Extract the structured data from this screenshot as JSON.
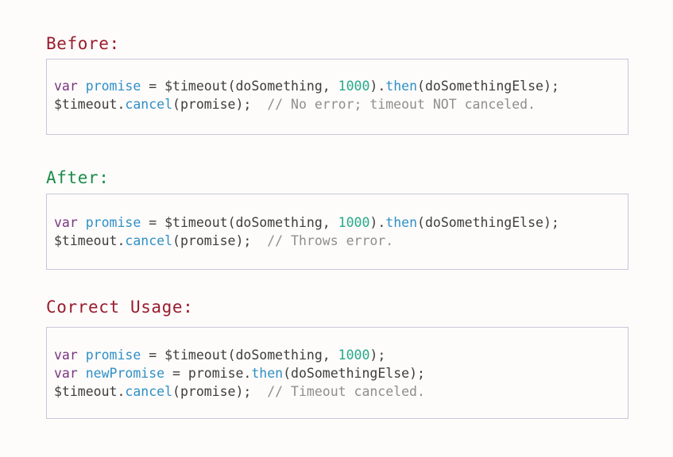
{
  "colors": {
    "heading_red": "#9b1c2c",
    "heading_green": "#1c8c4a",
    "keyword": "#7a3580",
    "identifier_blue": "#2f8fc6",
    "number": "#27a989",
    "comment": "#8e8e8e",
    "plain": "#3d3d3d",
    "border": "#c8c6d8"
  },
  "sections": [
    {
      "heading": "Before:",
      "lines": [
        [
          {
            "t": "var",
            "c": "kw"
          },
          {
            "t": " ",
            "c": "pl"
          },
          {
            "t": "promise",
            "c": "var"
          },
          {
            "t": " = $timeout(doSomething, ",
            "c": "pl"
          },
          {
            "t": "1000",
            "c": "num"
          },
          {
            "t": ").",
            "c": "pl"
          },
          {
            "t": "then",
            "c": "fn"
          },
          {
            "t": "(doSomethingElse);",
            "c": "pl"
          }
        ],
        [
          {
            "t": "$timeout.",
            "c": "pl"
          },
          {
            "t": "cancel",
            "c": "fn"
          },
          {
            "t": "(promise);  ",
            "c": "pl"
          },
          {
            "t": "// No error; timeout NOT canceled.",
            "c": "cm"
          }
        ]
      ]
    },
    {
      "heading": "After:",
      "lines": [
        [
          {
            "t": "var",
            "c": "kw"
          },
          {
            "t": " ",
            "c": "pl"
          },
          {
            "t": "promise",
            "c": "var"
          },
          {
            "t": " = $timeout(doSomething, ",
            "c": "pl"
          },
          {
            "t": "1000",
            "c": "num"
          },
          {
            "t": ").",
            "c": "pl"
          },
          {
            "t": "then",
            "c": "fn"
          },
          {
            "t": "(doSomethingElse);",
            "c": "pl"
          }
        ],
        [
          {
            "t": "$timeout.",
            "c": "pl"
          },
          {
            "t": "cancel",
            "c": "fn"
          },
          {
            "t": "(promise);  ",
            "c": "pl"
          },
          {
            "t": "// Throws error.",
            "c": "cm"
          }
        ]
      ]
    },
    {
      "heading": "Correct Usage:",
      "lines": [
        [
          {
            "t": "var",
            "c": "kw"
          },
          {
            "t": " ",
            "c": "pl"
          },
          {
            "t": "promise",
            "c": "var"
          },
          {
            "t": " = $timeout(doSomething, ",
            "c": "pl"
          },
          {
            "t": "1000",
            "c": "num"
          },
          {
            "t": ");",
            "c": "pl"
          }
        ],
        [
          {
            "t": "var",
            "c": "kw"
          },
          {
            "t": " ",
            "c": "pl"
          },
          {
            "t": "newPromise",
            "c": "var"
          },
          {
            "t": " = promise.",
            "c": "pl"
          },
          {
            "t": "then",
            "c": "fn"
          },
          {
            "t": "(doSomethingElse);",
            "c": "pl"
          }
        ],
        [
          {
            "t": "$timeout.",
            "c": "pl"
          },
          {
            "t": "cancel",
            "c": "fn"
          },
          {
            "t": "(promise);  ",
            "c": "pl"
          },
          {
            "t": "// Timeout canceled.",
            "c": "cm"
          }
        ]
      ]
    }
  ]
}
